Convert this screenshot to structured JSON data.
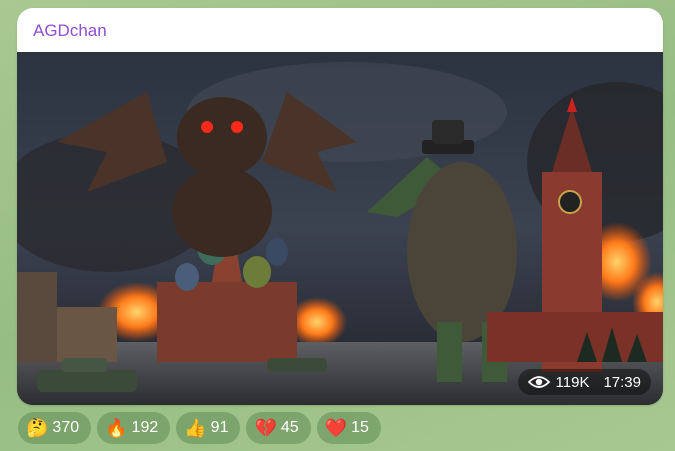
{
  "channel": {
    "name": "AGDchan",
    "name_color": "#8e4ed6"
  },
  "post": {
    "views": "119K",
    "time": "17:39"
  },
  "reactions": [
    {
      "emoji": "🤔",
      "icon": "thinking-face-icon",
      "count": "370"
    },
    {
      "emoji": "🔥",
      "icon": "fire-icon",
      "count": "192"
    },
    {
      "emoji": "👍",
      "icon": "thumbs-up-icon",
      "count": "91"
    },
    {
      "emoji": "💔",
      "icon": "broken-heart-icon",
      "count": "45"
    },
    {
      "emoji": "❤️",
      "icon": "red-heart-icon",
      "count": "15"
    }
  ],
  "colors": {
    "chat_background": "#9fc28a",
    "reaction_background": "rgba(96,140,86,0.55)"
  }
}
